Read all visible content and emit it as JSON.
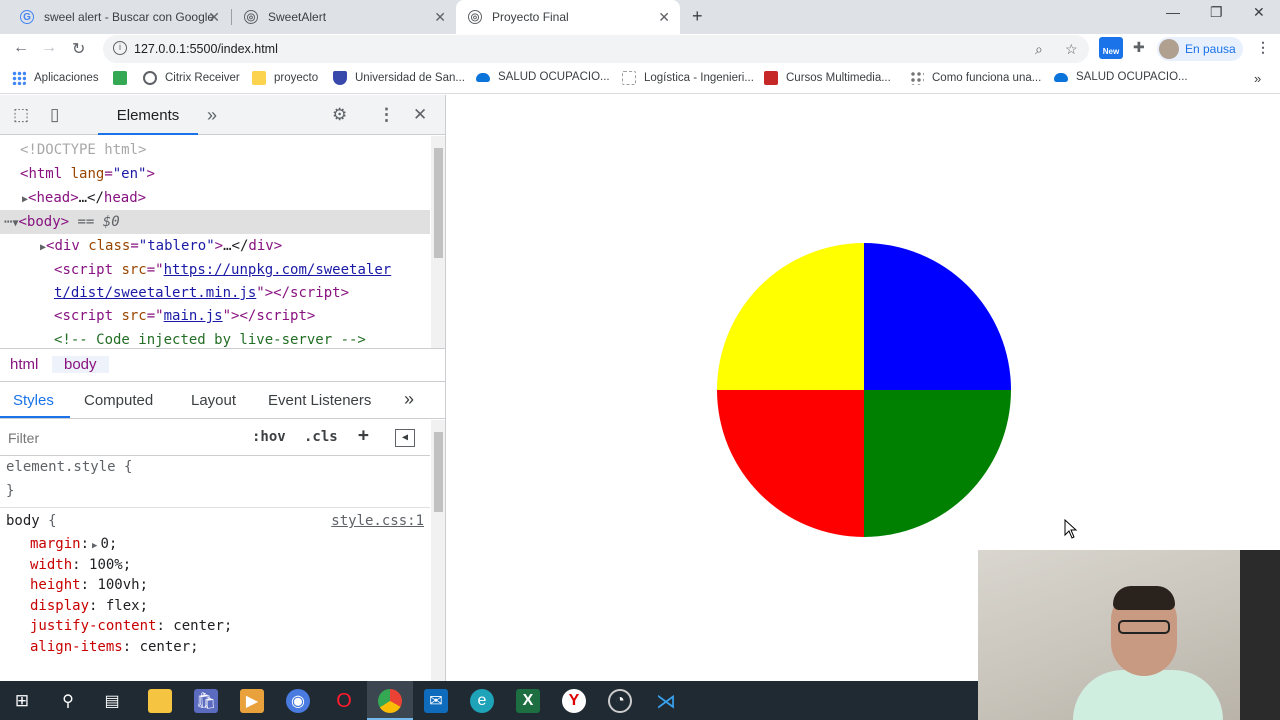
{
  "browser": {
    "tabs": [
      {
        "title": "sweel alert - Buscar con Google",
        "icon": "google-g-icon"
      },
      {
        "title": "SweetAlert",
        "icon": "globe-icon"
      },
      {
        "title": "Proyecto Final",
        "icon": "globe-icon",
        "active": true
      }
    ],
    "url": "127.0.0.1:5500/index.html",
    "profile_label": "En pausa",
    "ext_badge": "New"
  },
  "bookmarks": [
    {
      "label": "Aplicaciones",
      "icon": "apps-grid-icon",
      "color": "#4285f4"
    },
    {
      "label": "",
      "icon": "green-square-icon",
      "color": "#34a853"
    },
    {
      "label": "Citrix Receiver",
      "icon": "citrix-icon",
      "color": "#5f6368"
    },
    {
      "label": "proyecto",
      "icon": "folder-icon",
      "color": "#fbd34e"
    },
    {
      "label": "Universidad de San...",
      "icon": "shield-icon",
      "color": "#3949ab"
    },
    {
      "label": "SALUD OCUPACIO...",
      "icon": "onedrive-icon",
      "color": "#0a74da"
    },
    {
      "label": "Logística - Ingenieri...",
      "icon": "page-icon",
      "color": "#9e9e9e"
    },
    {
      "label": "Cursos Multimedia...",
      "icon": "youtube-icon",
      "color": "#c62828"
    },
    {
      "label": "Como funciona una...",
      "icon": "dots-icon",
      "color": "#757575"
    },
    {
      "label": "SALUD OCUPACIO...",
      "icon": "onedrive-icon",
      "color": "#0a74da"
    }
  ],
  "devtools": {
    "active_tab": "Elements",
    "dom": {
      "doctype": "<!DOCTYPE html>",
      "html_open_tag": "html",
      "html_attr": "lang",
      "html_attr_val": "\"en\"",
      "head": "head",
      "head_ellipsis": "…</",
      "body": "body",
      "body_eq": "== $0",
      "div_tag": "div",
      "div_attr": "class",
      "div_val": "\"tablero\"",
      "div_ellipsis": "…</",
      "script_tag": "script",
      "script_attr": "src",
      "script1_src_a": "https://unpkg.com/sweetaler",
      "script1_src_b": "t/dist/sweetalert.min.js",
      "script2_src": "main.js",
      "comment": "<!-- Code injected by live-server -->"
    },
    "breadcrumbs": [
      "html",
      "body"
    ],
    "style_tabs": [
      "Styles",
      "Computed",
      "Layout",
      "Event Listeners"
    ],
    "filter_placeholder": "Filter",
    "hov": ":hov",
    "cls": ".cls",
    "element_style": "element.style {",
    "close_brace": "}",
    "body_rule": {
      "selector": "body",
      "source": "style.css:1",
      "props": [
        {
          "name": "margin",
          "value": "0",
          "expand": true
        },
        {
          "name": "width",
          "value": "100%"
        },
        {
          "name": "height",
          "value": "100vh"
        },
        {
          "name": "display",
          "value": "flex"
        },
        {
          "name": "justify-content",
          "value": "center"
        },
        {
          "name": "align-items",
          "value": "center"
        }
      ]
    }
  },
  "board": {
    "quadrants": [
      {
        "name": "top-left",
        "color": "#ffff00"
      },
      {
        "name": "top-right",
        "color": "#0000ff"
      },
      {
        "name": "bottom-left",
        "color": "#ff0000"
      },
      {
        "name": "bottom-right",
        "color": "#008000"
      }
    ]
  },
  "taskbar": {
    "icons": [
      "windows-start-icon",
      "search-icon",
      "task-view-icon",
      "file-explorer-icon",
      "store-icon",
      "media-player-icon",
      "chromium-icon",
      "opera-icon",
      "chrome-icon",
      "mail-icon",
      "edge-icon",
      "excel-icon",
      "yandex-icon",
      "obs-icon",
      "vscode-icon"
    ]
  }
}
